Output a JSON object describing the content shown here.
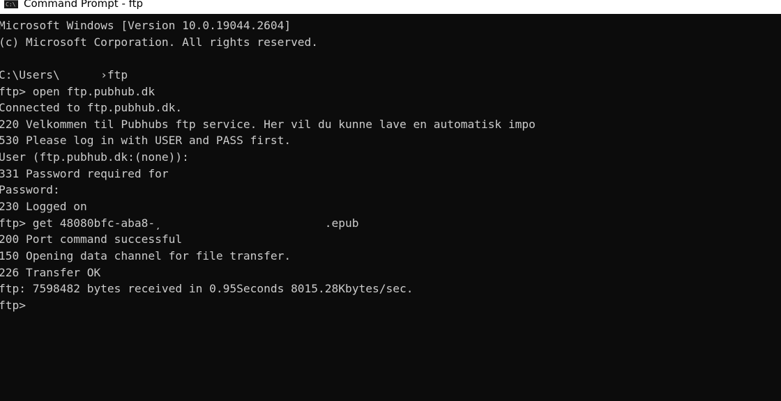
{
  "window": {
    "title": "Command Prompt - ftp",
    "icon": "console-icon"
  },
  "terminal": {
    "lines": [
      "Microsoft Windows [Version 10.0.19044.2604]",
      "(c) Microsoft Corporation. All rights reserved.",
      "",
      "C:\\Users\\      ›ftp",
      "ftp> open ftp.pubhub.dk",
      "Connected to ftp.pubhub.dk.",
      "220 Velkommen til Pubhubs ftp service. Her vil du kunne lave en automatisk impo",
      "530 Please log in with USER and PASS first.",
      "User (ftp.pubhub.dk:(none)):",
      "331 Password required for",
      "Password:",
      "230 Logged on",
      "ftp> get 48080bfc-aba8-̦                         .epub",
      "200 Port command successful",
      "150 Opening data channel for file transfer.",
      "226 Transfer OK",
      "ftp: 7598482 bytes received in 0.95Seconds 8015.28Kbytes/sec.",
      "ftp>"
    ]
  },
  "colors": {
    "background": "#0c0c0c",
    "text": "#cccccc",
    "titlebar": "#ffffff"
  }
}
